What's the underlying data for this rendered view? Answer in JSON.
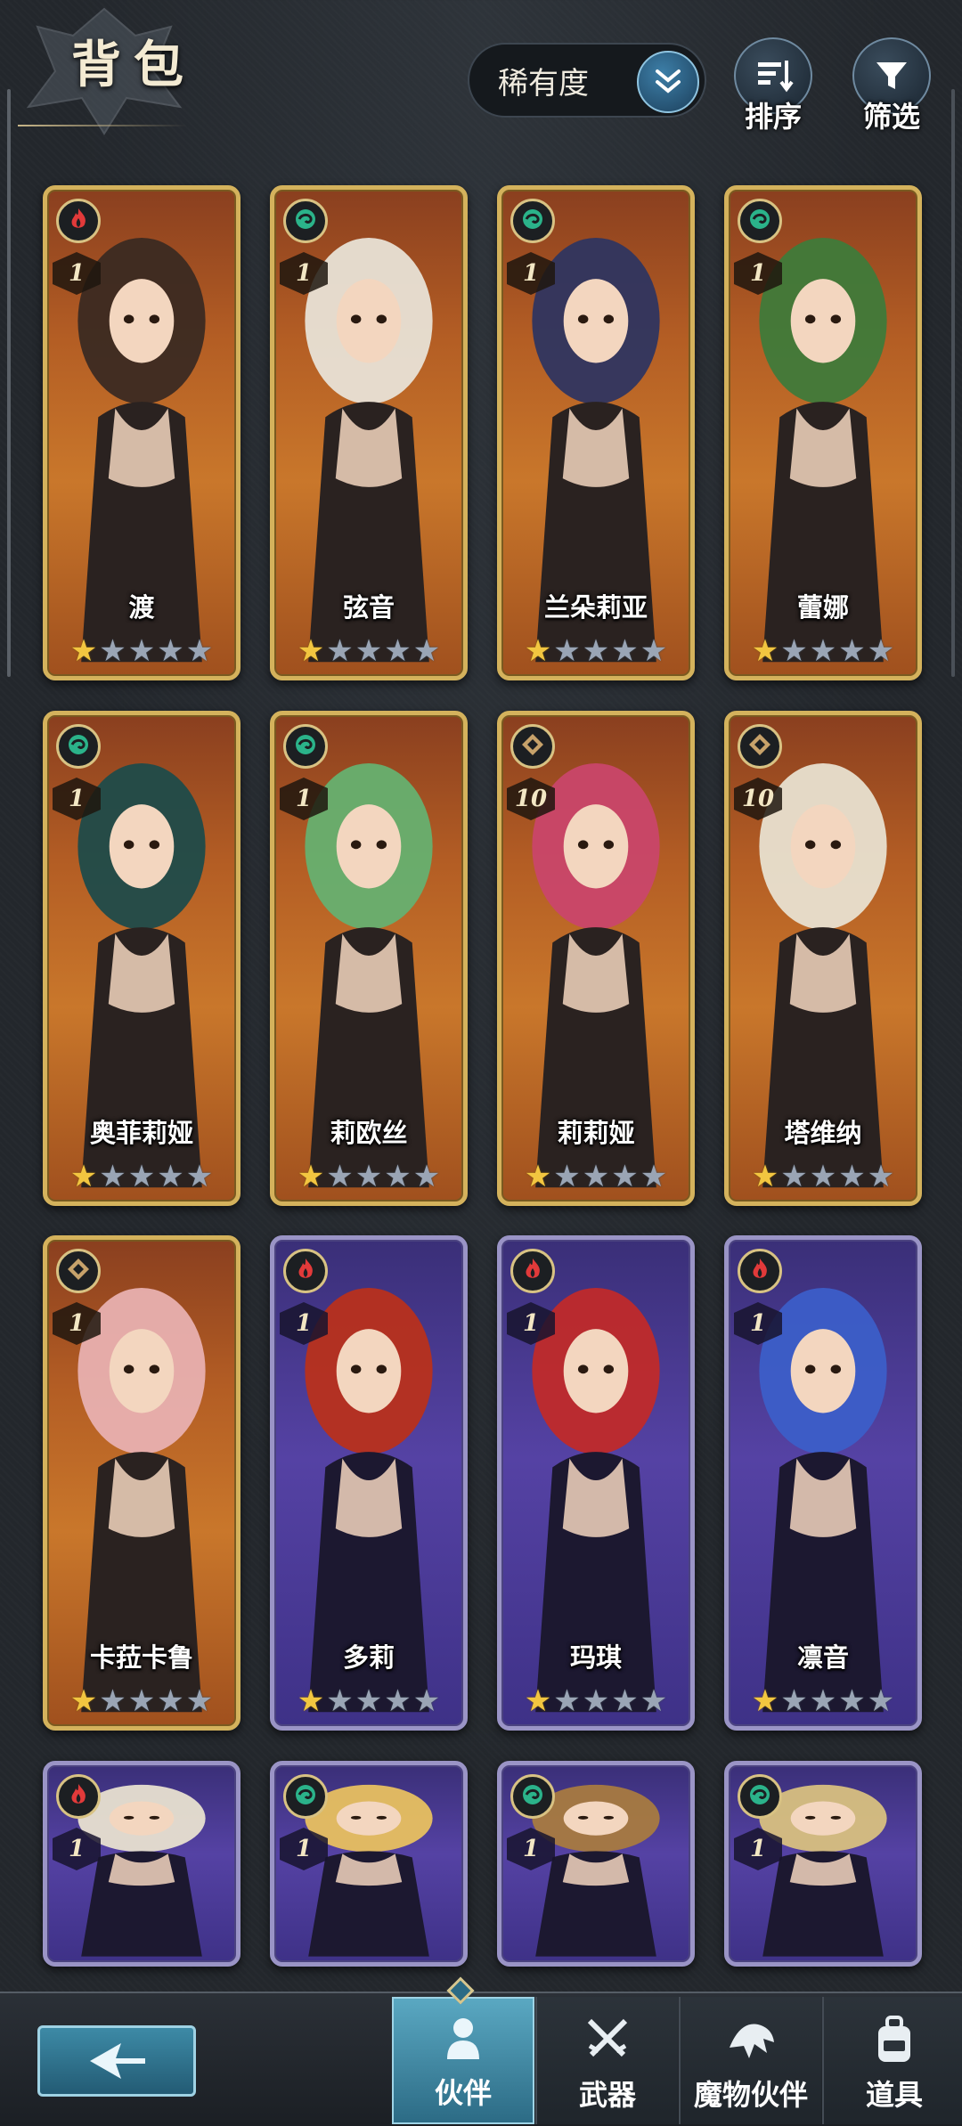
{
  "header": {
    "title": "背包",
    "sort_value": "稀有度",
    "sort_button": "排序",
    "filter_button": "筛选"
  },
  "colors": {
    "gold_frame": "#d4b25c",
    "purple_frame": "#9a94c6",
    "star_on": "#f2c640",
    "star_off": "#9aa5b5",
    "active_tab": "#3d8aa6"
  },
  "cards": [
    {
      "name": "渡",
      "level": "1",
      "element": "fire-icon",
      "rarity": "gold",
      "stars": 1
    },
    {
      "name": "弦音",
      "level": "1",
      "element": "wind-icon",
      "rarity": "gold",
      "stars": 1
    },
    {
      "name": "兰朵莉亚",
      "level": "1",
      "element": "wind-icon",
      "rarity": "gold",
      "stars": 1
    },
    {
      "name": "蕾娜",
      "level": "1",
      "element": "wind-icon",
      "rarity": "gold",
      "stars": 1
    },
    {
      "name": "奥菲莉娅",
      "level": "1",
      "element": "wind-icon",
      "rarity": "gold",
      "stars": 1
    },
    {
      "name": "莉欧丝",
      "level": "1",
      "element": "wind-icon",
      "rarity": "gold",
      "stars": 1
    },
    {
      "name": "莉莉娅",
      "level": "10",
      "element": "earth-icon",
      "rarity": "gold",
      "stars": 1
    },
    {
      "name": "塔维纳",
      "level": "10",
      "element": "earth-icon",
      "rarity": "gold",
      "stars": 1
    },
    {
      "name": "卡菈卡鲁",
      "level": "1",
      "element": "earth-icon",
      "rarity": "gold",
      "stars": 1
    },
    {
      "name": "多莉",
      "level": "1",
      "element": "fire-icon",
      "rarity": "purple",
      "stars": 1
    },
    {
      "name": "玛琪",
      "level": "1",
      "element": "fire-icon",
      "rarity": "purple",
      "stars": 1
    },
    {
      "name": "凛音",
      "level": "1",
      "element": "fire-icon",
      "rarity": "purple",
      "stars": 1
    },
    {
      "name": "",
      "level": "1",
      "element": "fire-icon",
      "rarity": "purple",
      "stars": 0
    },
    {
      "name": "",
      "level": "1",
      "element": "wind-icon",
      "rarity": "purple",
      "stars": 0
    },
    {
      "name": "",
      "level": "1",
      "element": "wind-icon",
      "rarity": "purple",
      "stars": 0
    },
    {
      "name": "",
      "level": "1",
      "element": "wind-icon",
      "rarity": "purple",
      "stars": 0
    }
  ],
  "tabs": [
    {
      "label": "伙伴",
      "icon": "partner-icon",
      "active": true
    },
    {
      "label": "武器",
      "icon": "crossed-swords-icon",
      "active": false
    },
    {
      "label": "魔物伙伴",
      "icon": "monster-icon",
      "active": false
    },
    {
      "label": "道具",
      "icon": "backpack-icon",
      "active": false
    }
  ]
}
